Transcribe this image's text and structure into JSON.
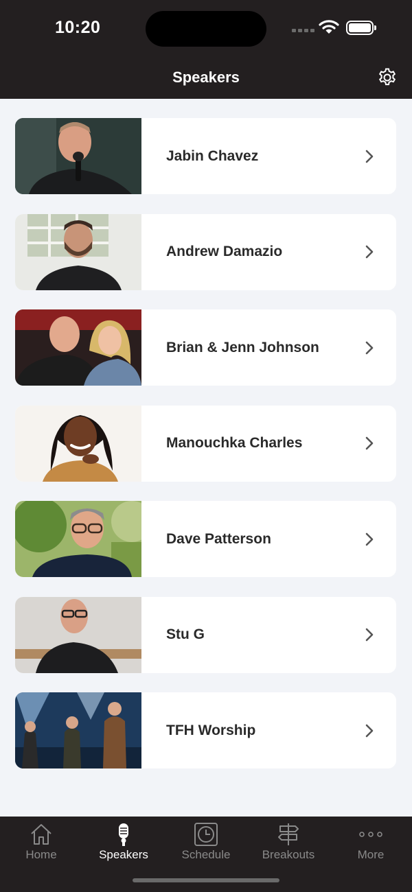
{
  "status": {
    "time": "10:20"
  },
  "header": {
    "title": "Speakers"
  },
  "speakers": [
    {
      "name": "Jabin Chavez"
    },
    {
      "name": "Andrew Damazio"
    },
    {
      "name": "Brian & Jenn Johnson"
    },
    {
      "name": "Manouchka Charles"
    },
    {
      "name": "Dave Patterson"
    },
    {
      "name": "Stu G"
    },
    {
      "name": "TFH Worship"
    }
  ],
  "tabs": [
    {
      "label": "Home",
      "icon": "home-icon"
    },
    {
      "label": "Speakers",
      "icon": "microphone-icon"
    },
    {
      "label": "Schedule",
      "icon": "clock-icon"
    },
    {
      "label": "Breakouts",
      "icon": "signpost-icon"
    },
    {
      "label": "More",
      "icon": "more-icon"
    }
  ],
  "colors": {
    "bar": "#231f20",
    "background": "#f2f4f8",
    "card": "#ffffff",
    "active_tab": "#ffffff",
    "inactive_tab": "#8a8a8a"
  }
}
